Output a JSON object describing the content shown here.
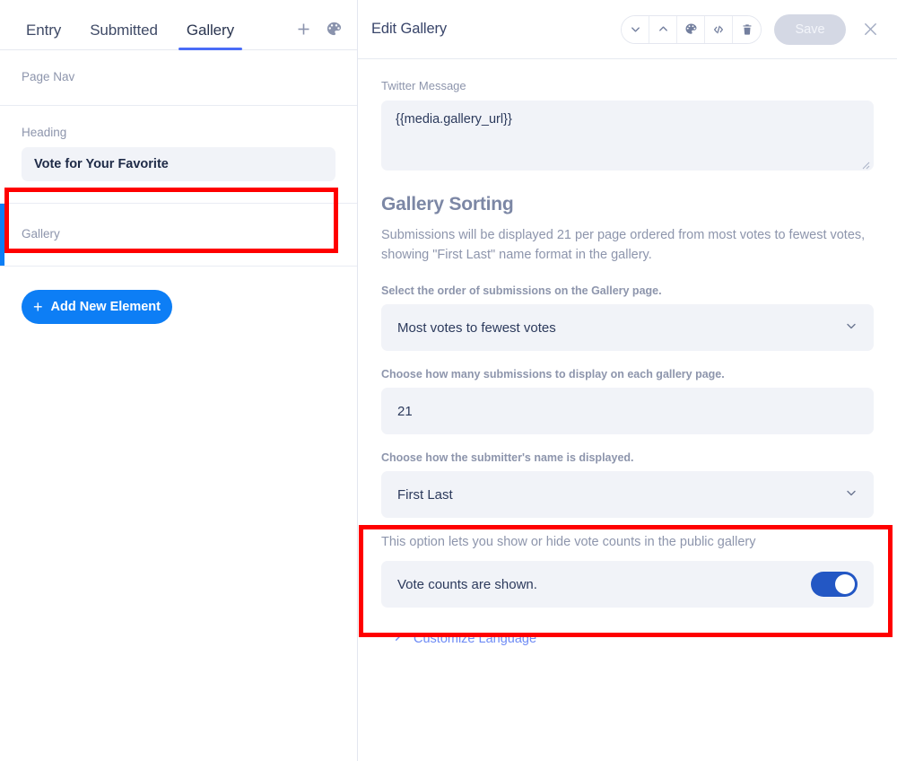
{
  "left_panel": {
    "tabs": [
      {
        "label": "Entry",
        "active": false
      },
      {
        "label": "Submitted",
        "active": false
      },
      {
        "label": "Gallery",
        "active": true
      }
    ],
    "tab_actions": [
      {
        "name": "add-page-icon",
        "glyph": "+"
      },
      {
        "name": "palette-icon",
        "glyph": "palette"
      }
    ],
    "page_nav_label": "Page Nav",
    "heading_field": {
      "label": "Heading",
      "value": "Vote for Your Favorite"
    },
    "gallery_element": {
      "label": "Gallery",
      "selected": true
    },
    "add_element_button": "Add New Element"
  },
  "right_panel": {
    "title": "Edit Gallery",
    "header_icons": [
      {
        "name": "chevron-down-icon",
        "label": "Move down"
      },
      {
        "name": "chevron-up-icon",
        "label": "Move up"
      },
      {
        "name": "palette-icon",
        "label": "Style"
      },
      {
        "name": "code-icon",
        "label": "Custom code"
      },
      {
        "name": "trash-icon",
        "label": "Delete"
      }
    ],
    "save_label": "Save",
    "close_label": "Close",
    "twitter_message": {
      "label": "Twitter Message",
      "value": "{{media.gallery_url}}"
    },
    "gallery_sorting": {
      "title": "Gallery Sorting",
      "description": "Submissions will be displayed 21 per page ordered from most votes to fewest votes, showing \"First Last\" name format in the gallery.",
      "order_label": "Select the order of submissions on the Gallery page.",
      "order_value": "Most votes to fewest votes",
      "per_page_label": "Choose how many submissions to display on each gallery page.",
      "per_page_value": "21",
      "name_format_label": "Choose how the submitter's name is displayed.",
      "name_format_value": "First Last"
    },
    "vote_counts": {
      "description": "This option lets you show or hide vote counts in the public gallery",
      "toggle_text": "Vote counts are shown.",
      "toggle_on": true
    },
    "customize_language": "Customize Language"
  },
  "colors": {
    "accent_blue": "#0d7ef5",
    "toggle_blue": "#2357c4",
    "tab_underline": "#4a6cf7",
    "annotation_red": "#ff0000",
    "input_bg": "#f1f3f8",
    "text_dark": "#2c3a5c",
    "text_muted": "#8d95ac"
  }
}
